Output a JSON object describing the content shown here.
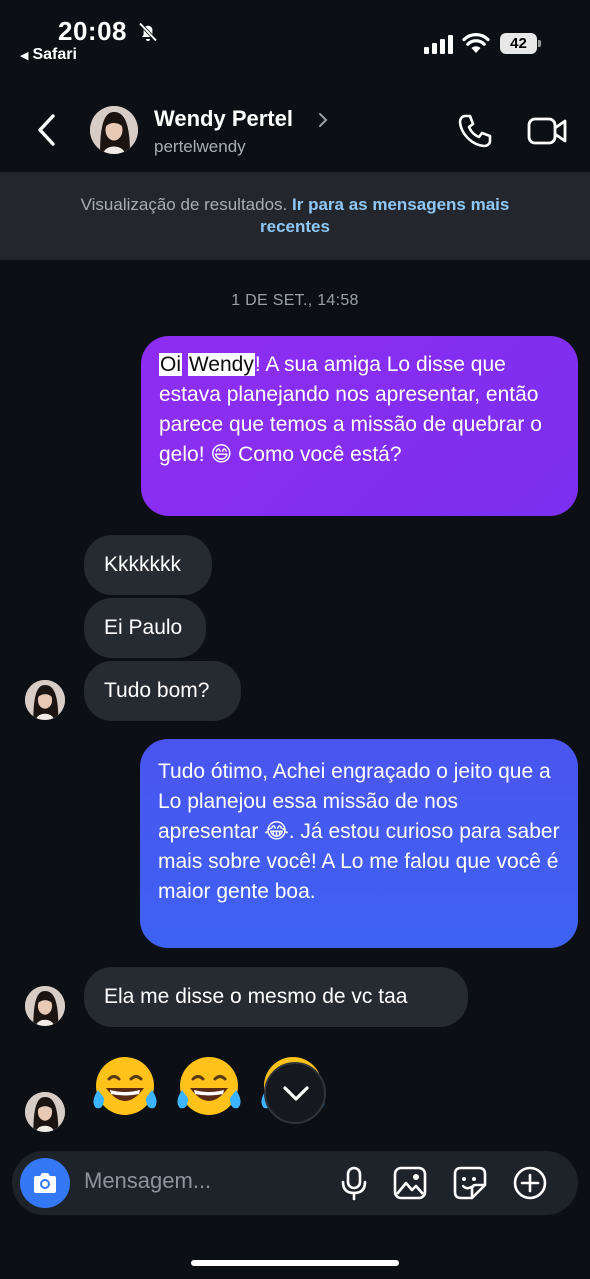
{
  "status_bar": {
    "time": "20:08",
    "back_app": "Safari",
    "battery": "42"
  },
  "header": {
    "name": "Wendy Pertel",
    "username": "pertelwendy"
  },
  "banner": {
    "text": "Visualização de resultados.",
    "link": "Ir para as mensagens mais recentes"
  },
  "timestamp": "1 DE SET., 14:58",
  "messages": {
    "out1": {
      "hl1": "Oi",
      "hl2": "Wendy",
      "text_rest": "! A sua amiga Lo disse que estava planejando nos apresentar, então parece que temos a missão de quebrar o gelo! 😄 Como você está?"
    },
    "in1": "Kkkkkkk",
    "in2": "Ei Paulo",
    "in3": "Tudo bom?",
    "out2": "Tudo ótimo, Achei engraçado o jeito que a Lo planejou essa missão de nos apresentar 😂. Já estou curioso para saber mais sobre você! A Lo me falou que você é maior gente boa.",
    "in4": "Ela me disse o mesmo de vc taa"
  },
  "composer": {
    "placeholder": "Mensagem..."
  },
  "colors": {
    "bubble_out_1": "#8f2df2",
    "bubble_out_2": "#3e62f2",
    "bubble_in": "#262a31",
    "link": "#8fc8f6",
    "camera": "#3478f6"
  }
}
